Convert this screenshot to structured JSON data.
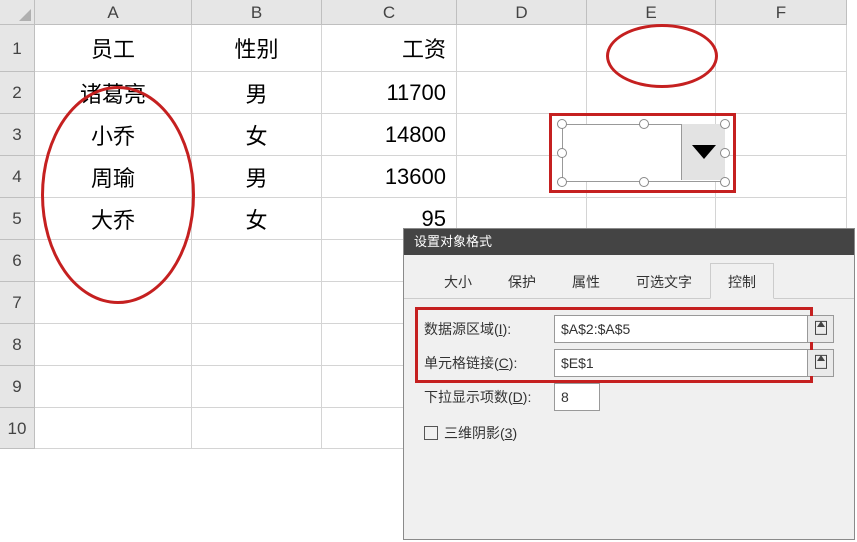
{
  "columns": [
    "A",
    "B",
    "C",
    "D",
    "E",
    "F"
  ],
  "rows": [
    "1",
    "2",
    "3",
    "4",
    "5",
    "6",
    "7",
    "8",
    "9",
    "10"
  ],
  "cells": {
    "A1": "员工",
    "B1": "性别",
    "C1": "工资",
    "A2": "诸葛亮",
    "B2": "男",
    "C2": "11700",
    "A3": "小乔",
    "B3": "女",
    "C3": "14800",
    "A4": "周瑜",
    "B4": "男",
    "C4": "13600",
    "A5": "大乔",
    "B5": "女",
    "C5": "95"
  },
  "dialog": {
    "title": "设置对象格式",
    "tabs": [
      "大小",
      "保护",
      "属性",
      "可选文字",
      "控制"
    ],
    "active_tab": 4,
    "source_label_pre": "数据源区域(",
    "source_label_u": "I",
    "source_label_post": "):",
    "source_value": "$A$2:$A$5",
    "link_label_pre": "单元格链接(",
    "link_label_u": "C",
    "link_label_post": "):",
    "link_value": "$E$1",
    "dropdown_label_pre": "下拉显示项数(",
    "dropdown_label_u": "D",
    "dropdown_label_post": "):",
    "dropdown_value": "8",
    "shadow_label_pre": "三维阴影(",
    "shadow_label_u": "3",
    "shadow_label_post": ")"
  },
  "chart_data": {
    "type": "table",
    "columns": [
      "员工",
      "性别",
      "工资"
    ],
    "rows": [
      [
        "诸葛亮",
        "男",
        11700
      ],
      [
        "小乔",
        "女",
        14800
      ],
      [
        "周瑜",
        "男",
        13600
      ],
      [
        "大乔",
        "女",
        "95"
      ]
    ]
  }
}
